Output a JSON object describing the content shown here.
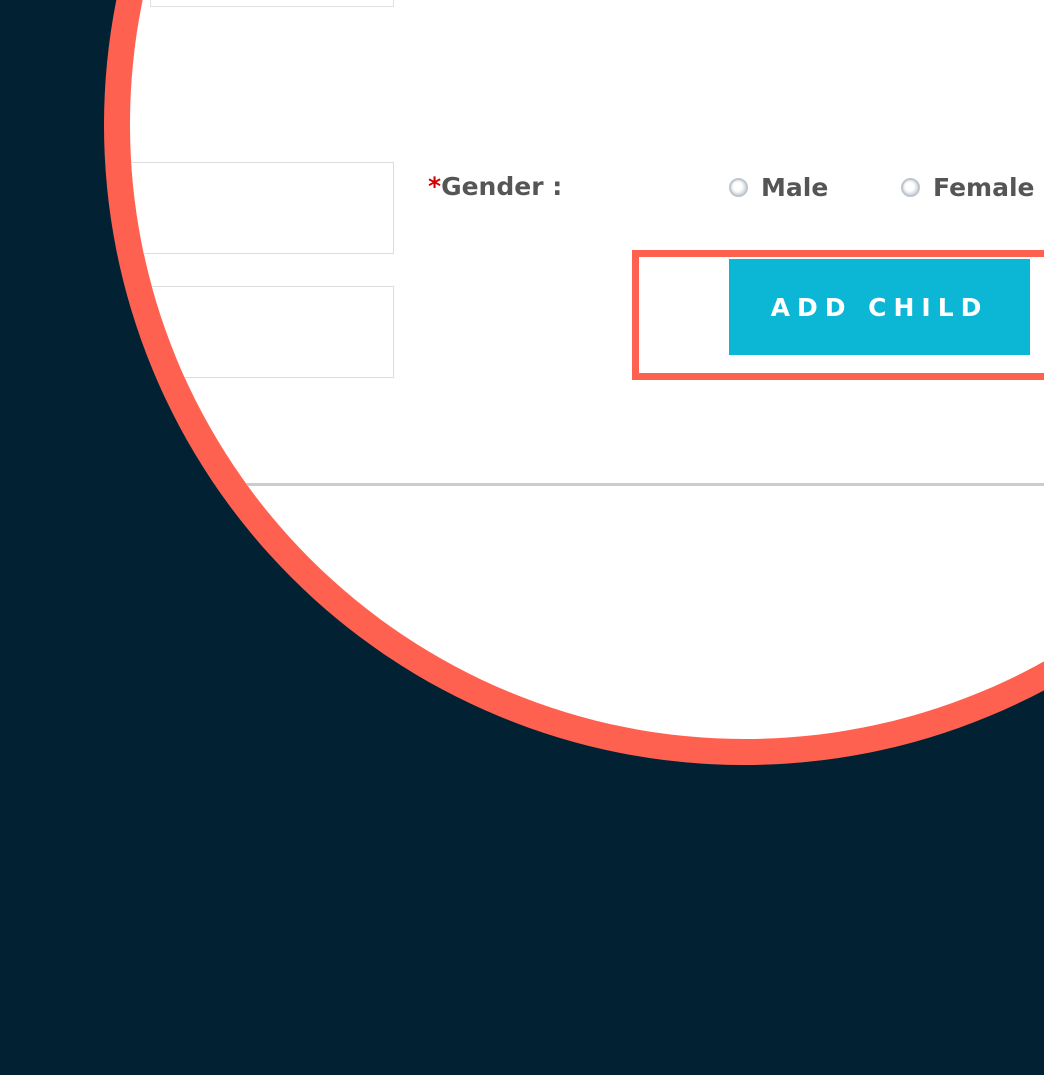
{
  "form": {
    "gender_label": "Gender :",
    "required_marker": "*",
    "gender_options": [
      {
        "label": "Male",
        "selected": false
      },
      {
        "label": "Female",
        "selected": false
      }
    ],
    "add_child_button": "ADD CHILD"
  },
  "colors": {
    "background": "#022233",
    "highlight": "#ff6150",
    "button": "#0bb7d5",
    "required": "#d40000"
  }
}
